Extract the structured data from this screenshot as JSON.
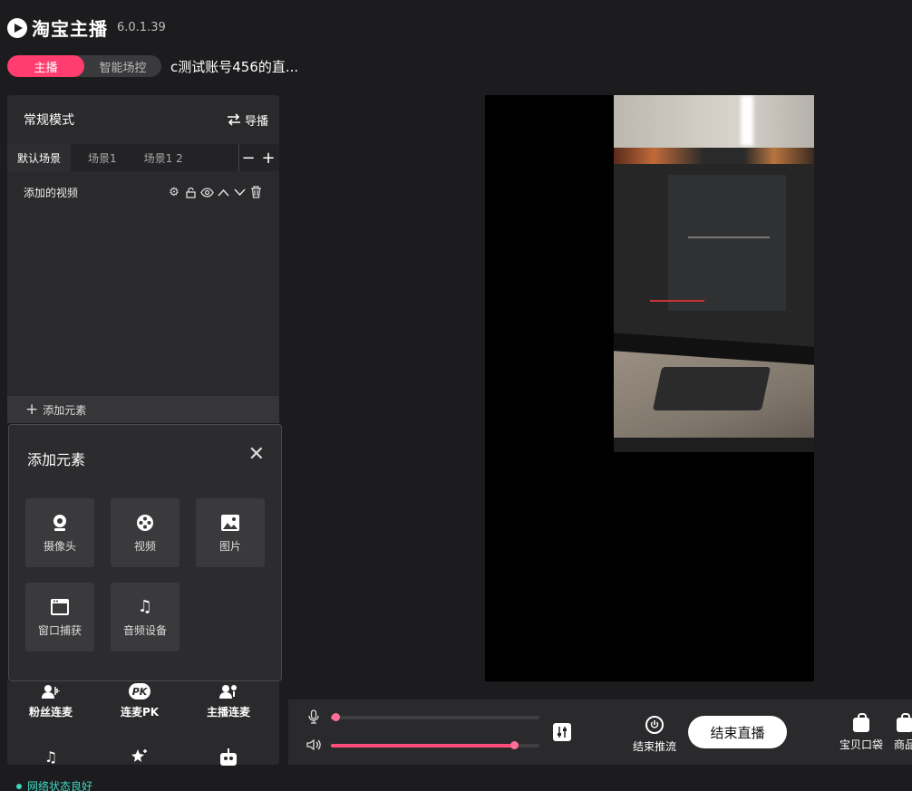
{
  "app": {
    "name": "淘宝主播",
    "version": "6.0.1.39"
  },
  "mode_tabs": [
    {
      "label": "主播",
      "active": true
    },
    {
      "label": "智能场控",
      "active": false
    }
  ],
  "room_title": "c测试账号456的直...",
  "scene_panel": {
    "mode_label": "常规模式",
    "director_label": "导播",
    "scenes": [
      {
        "label": "默认场景",
        "active": true
      },
      {
        "label": "场景1",
        "active": false
      },
      {
        "label": "场景1 2",
        "active": false
      }
    ],
    "remove_symbol": "−",
    "add_symbol": "+",
    "sources": [
      {
        "label": "添加的视频"
      }
    ],
    "add_element_label": "添加元素"
  },
  "add_element_popup": {
    "title": "添加元素",
    "close_symbol": "✕",
    "items": [
      {
        "label": "摄像头",
        "icon": "webcam-icon"
      },
      {
        "label": "视频",
        "icon": "film-reel-icon"
      },
      {
        "label": "图片",
        "icon": "image-icon"
      },
      {
        "label": "窗口捕获",
        "icon": "window-icon"
      },
      {
        "label": "音频设备",
        "icon": "music-note-icon"
      }
    ]
  },
  "bottom_tools": [
    {
      "label": "粉丝连麦",
      "icon": "fans-connect-icon"
    },
    {
      "label": "连麦PK",
      "icon": "pk-icon"
    },
    {
      "label": "主播连麦",
      "icon": "anchor-connect-icon"
    },
    {
      "label": "",
      "icon": "music-note-icon"
    },
    {
      "label": "",
      "icon": "magic-icon"
    },
    {
      "label": "",
      "icon": "robot-icon"
    }
  ],
  "pk_badge": "PK",
  "network_status": "网络状态良好",
  "audio": {
    "mic_level": 0.02,
    "speaker_level": 0.88
  },
  "controls": {
    "end_push_label": "结束推流",
    "end_live_label": "结束直播",
    "bag_label": "宝贝口袋",
    "goods_label": "商品"
  },
  "colors": {
    "accent": "#ff3d6f",
    "background": "#1c1c1e",
    "panel": "#2a2a2c",
    "status_ok": "#3fd6c0"
  }
}
